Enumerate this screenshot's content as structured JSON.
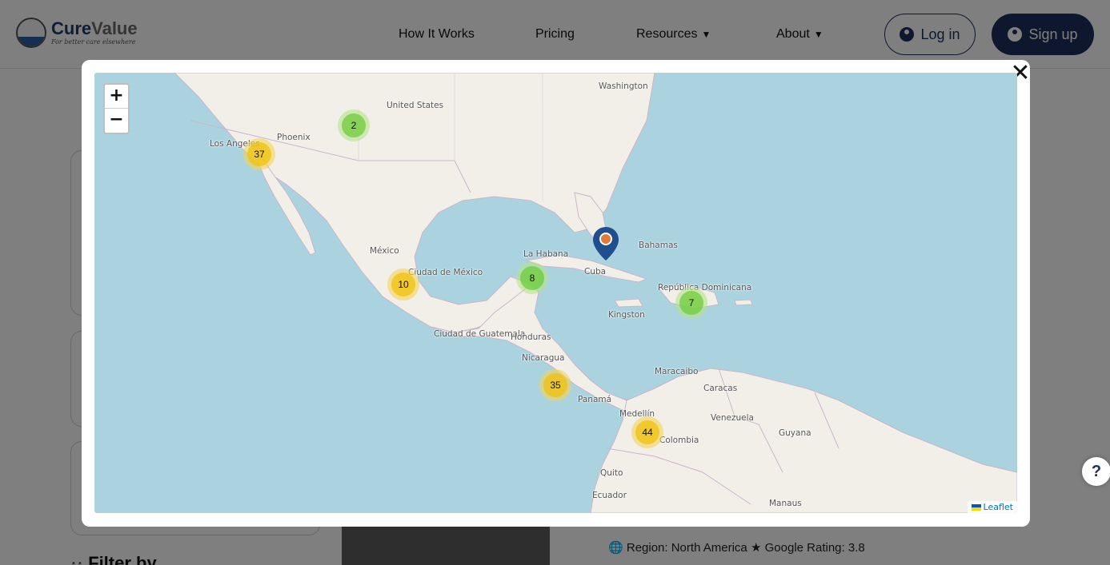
{
  "brand": {
    "name_part1": "Cure",
    "name_part2": "Value",
    "tagline": "For better care elsewhere"
  },
  "nav": [
    {
      "label": "How It Works",
      "dropdown": false
    },
    {
      "label": "Pricing",
      "dropdown": false
    },
    {
      "label": "Resources",
      "dropdown": true
    },
    {
      "label": "About",
      "dropdown": true
    }
  ],
  "auth": {
    "login_label": "Log in",
    "signup_label": "Sign up"
  },
  "background": {
    "filter_label": "Filter by",
    "region_label": "Region: North America",
    "rating_label": "Google Rating: 3.8"
  },
  "map": {
    "zoom_in": "+",
    "zoom_out": "−",
    "attribution": "Leaflet",
    "places": [
      "Washington",
      "United States",
      "Phoenix",
      "Los Angeles",
      "México",
      "Ciudad de México",
      "La Habana",
      "Cuba",
      "Bahamas",
      "República Dominicana",
      "Kingston",
      "Ciudad de Guatemala",
      "Honduras",
      "Nicaragua",
      "Panamá",
      "Maracaibo",
      "Caracas",
      "Venezuela",
      "Medellín",
      "Colombia",
      "Guyana",
      "Quito",
      "Ecuador",
      "Manaus"
    ],
    "clusters": [
      {
        "count": "2",
        "color": "green"
      },
      {
        "count": "37",
        "color": "yellow"
      },
      {
        "count": "10",
        "color": "yellow"
      },
      {
        "count": "8",
        "color": "green"
      },
      {
        "count": "7",
        "color": "green"
      },
      {
        "count": "35",
        "color": "yellow"
      },
      {
        "count": "44",
        "color": "yellow"
      }
    ],
    "marker_color": "#1f4f8e",
    "marker_dot_color": "#e07b39",
    "water_color": "#aad3df",
    "land_color": "#f2efe9"
  },
  "close_icon": "close-icon"
}
